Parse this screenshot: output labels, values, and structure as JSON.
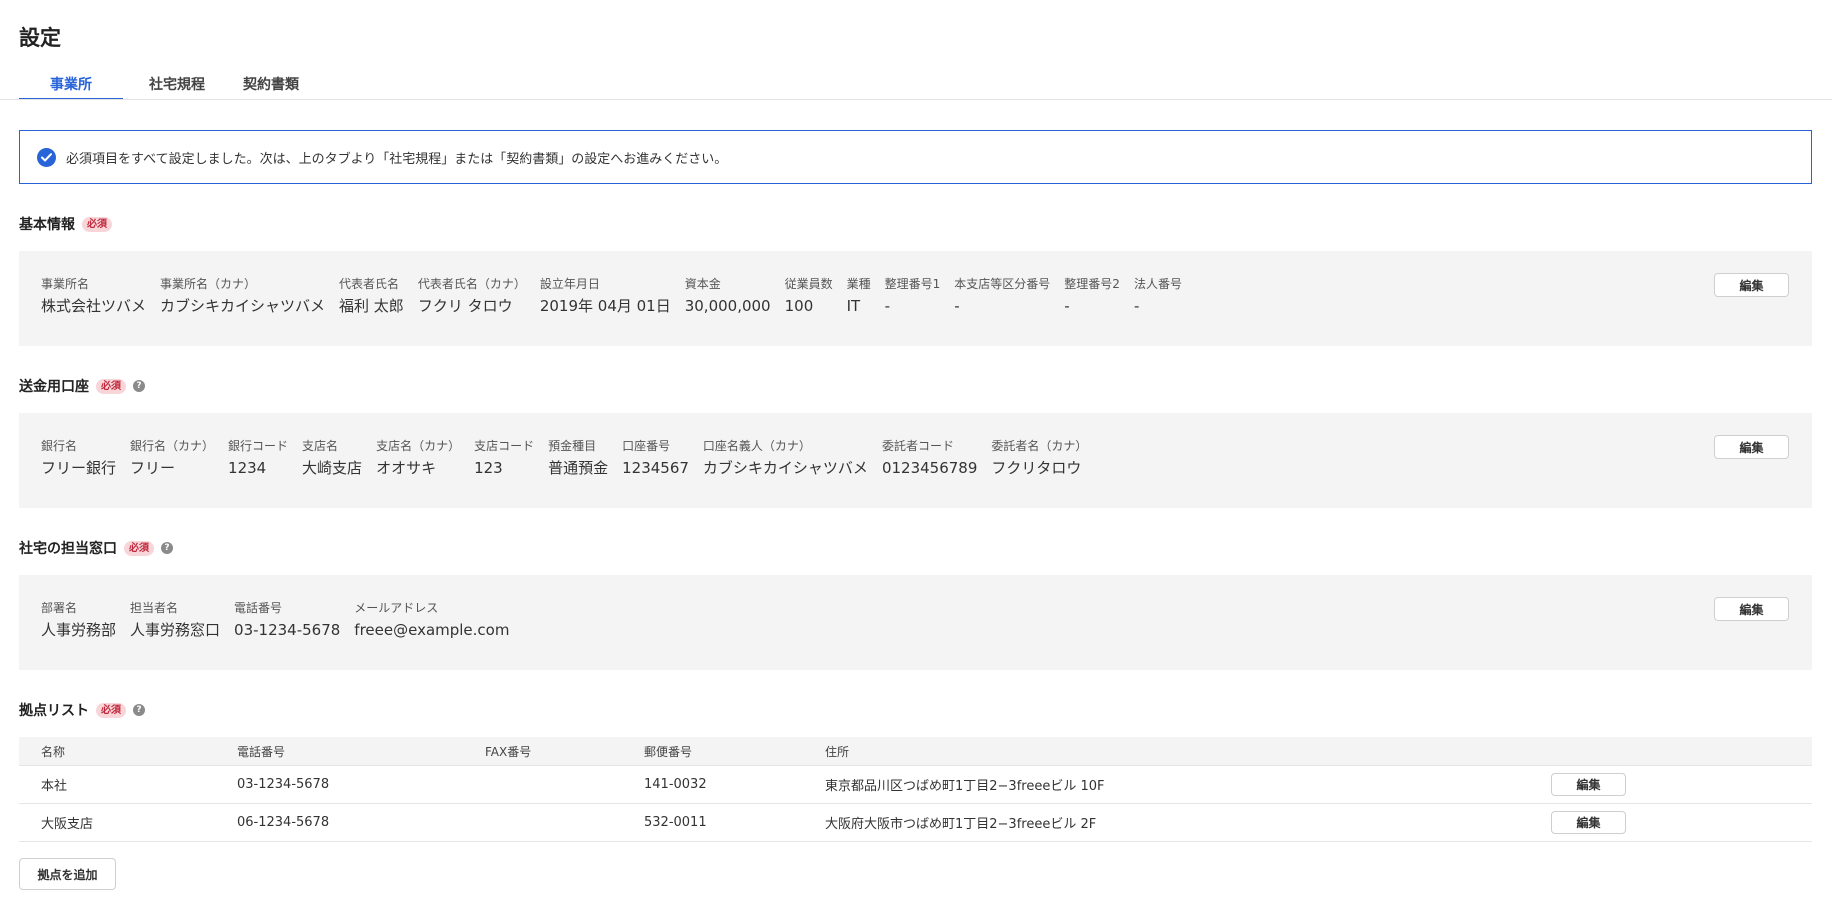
{
  "page": {
    "title": "設定"
  },
  "tabs": [
    {
      "label": "事業所",
      "active": true
    },
    {
      "label": "社宅規程",
      "active": false
    },
    {
      "label": "契約書類",
      "active": false
    }
  ],
  "notice": {
    "text": "必須項目をすべて設定しました。次は、上のタブより「社宅規程」または「契約書類」の設定へお進みください。",
    "icon": "check-circle-icon"
  },
  "colors": {
    "accent": "#2864d8",
    "required_bg": "#f7d5d9",
    "required_text": "#c0293c",
    "panel_bg": "#f5f4f4"
  },
  "edit_label": "編集",
  "required_label": "必須",
  "help_symbol": "?",
  "sections": {
    "basic": {
      "title": "基本情報",
      "fields": [
        {
          "label": "事業所名",
          "value": "株式会社ツバメ"
        },
        {
          "label": "事業所名（カナ）",
          "value": "カブシキカイシャツバメ"
        },
        {
          "label": "代表者氏名",
          "value": "福利 太郎"
        },
        {
          "label": "代表者氏名（カナ）",
          "value": "フクリ タロウ"
        },
        {
          "label": "設立年月日",
          "value": "2019年 04月 01日"
        },
        {
          "label": "資本金",
          "value": "30,000,000"
        },
        {
          "label": "従業員数",
          "value": "100"
        },
        {
          "label": "業種",
          "value": "IT"
        },
        {
          "label": "整理番号1",
          "value": "-"
        },
        {
          "label": "本支店等区分番号",
          "value": "-"
        },
        {
          "label": "整理番号2",
          "value": "-"
        },
        {
          "label": "法人番号",
          "value": "-"
        }
      ]
    },
    "bank": {
      "title": "送金用口座",
      "fields": [
        {
          "label": "銀行名",
          "value": "フリー銀行"
        },
        {
          "label": "銀行名（カナ）",
          "value": "フリー"
        },
        {
          "label": "銀行コード",
          "value": "1234"
        },
        {
          "label": "支店名",
          "value": "大崎支店"
        },
        {
          "label": "支店名（カナ）",
          "value": "オオサキ"
        },
        {
          "label": "支店コード",
          "value": "123"
        },
        {
          "label": "預金種目",
          "value": "普通預金"
        },
        {
          "label": "口座番号",
          "value": "1234567"
        },
        {
          "label": "口座名義人（カナ）",
          "value": "カブシキカイシャツバメ"
        },
        {
          "label": "委託者コード",
          "value": "0123456789"
        },
        {
          "label": "委託者名（カナ）",
          "value": "フクリタロウ"
        }
      ]
    },
    "contact": {
      "title": "社宅の担当窓口",
      "fields": [
        {
          "label": "部署名",
          "value": "人事労務部"
        },
        {
          "label": "担当者名",
          "value": "人事労務窓口"
        },
        {
          "label": "電話番号",
          "value": "03-1234-5678"
        },
        {
          "label": "メールアドレス",
          "value": "freee@example.com"
        }
      ]
    },
    "locations": {
      "title": "拠点リスト",
      "columns": [
        "名称",
        "電話番号",
        "FAX番号",
        "郵便番号",
        "住所"
      ],
      "rows": [
        {
          "name": "本社",
          "phone": "03-1234-5678",
          "fax": "",
          "zip": "141-0032",
          "address": "東京都品川区つばめ町1丁目2−3freeeビル 10F"
        },
        {
          "name": "大阪支店",
          "phone": "06-1234-5678",
          "fax": "",
          "zip": "532-0011",
          "address": "大阪府大阪市つばめ町1丁目2−3freeeビル 2F"
        }
      ],
      "add_label": "拠点を追加"
    }
  }
}
